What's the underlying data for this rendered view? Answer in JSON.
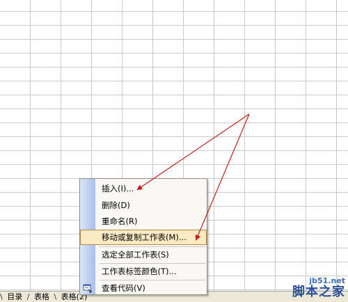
{
  "tabs": {
    "leading_sep": "\\",
    "items": [
      {
        "label": "目录"
      },
      {
        "label": "表格"
      },
      {
        "label": "表格(2)"
      }
    ]
  },
  "context_menu": {
    "items": [
      {
        "label": "插入(I)..."
      },
      {
        "label": "删除(D)"
      },
      {
        "label": "重命名(R)"
      },
      {
        "label": "移动或复制工作表(M)..."
      },
      {
        "label": "选定全部工作表(S)"
      },
      {
        "label": "工作表标签颜色(T)..."
      },
      {
        "label": "查看代码(V)"
      }
    ],
    "highlighted_index": 3,
    "icons": {
      "view_code": "code-window-icon"
    }
  },
  "annotation": {
    "color": "#c0201c"
  },
  "watermark": {
    "site": "jb51.net",
    "brand": "脚本之家"
  }
}
